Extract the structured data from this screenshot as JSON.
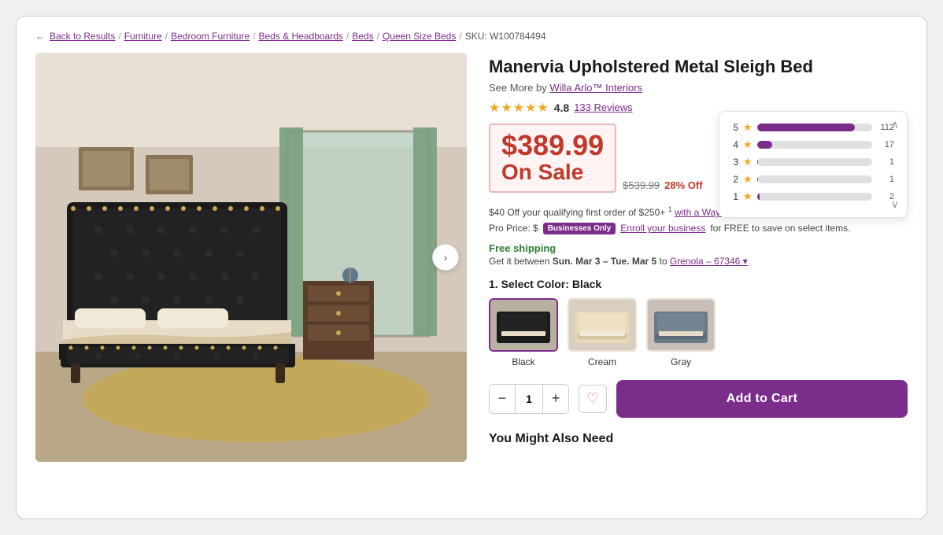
{
  "breadcrumb": {
    "back_label": "Back to Results",
    "items": [
      "Furniture",
      "Bedroom Furniture",
      "Beds & Headboards",
      "Beds",
      "Queen Size Beds"
    ],
    "sku": "SKU: W100784494"
  },
  "product": {
    "title": "Manervia Upholstered Metal Sleigh Bed",
    "brand": "Willa Arlo™ Interiors",
    "see_more_label": "See More by",
    "rating": "4.8",
    "reviews_count": "133 Reviews",
    "price_current": "$389.99",
    "on_sale_label": "On Sale",
    "price_original": "539.99",
    "discount": "28% Off",
    "credit_offer": "$40 Off your qualifying first order of $250+",
    "credit_link": "with a Wayfair credit card",
    "pro_price_label": "Pro Price: $",
    "businesses_only": "Businesses Only",
    "enroll_label": "Enroll your business",
    "enroll_suffix": "for FREE to save on select items.",
    "shipping_label": "Free shipping",
    "delivery_label": "Get it between",
    "delivery_dates": "Sun. Mar 3 – Tue. Mar 5",
    "delivery_to": "to",
    "delivery_location": "Grenola – 67346",
    "select_color_label": "1. Select Color:",
    "selected_color": "Black"
  },
  "colors": [
    {
      "name": "Black",
      "selected": true
    },
    {
      "name": "Cream",
      "selected": false
    },
    {
      "name": "Gray",
      "selected": false
    }
  ],
  "ratings_breakdown": [
    {
      "stars": 5,
      "count": 112,
      "pct": 85
    },
    {
      "stars": 4,
      "count": 17,
      "pct": 13
    },
    {
      "stars": 3,
      "count": 1,
      "pct": 1
    },
    {
      "stars": 2,
      "count": 1,
      "pct": 1
    },
    {
      "stars": 1,
      "count": 2,
      "pct": 2
    }
  ],
  "cart": {
    "qty": "1",
    "add_to_cart_label": "Add to Cart",
    "wishlist_icon": "♡"
  },
  "you_might_also_need": "You Might Also Need"
}
